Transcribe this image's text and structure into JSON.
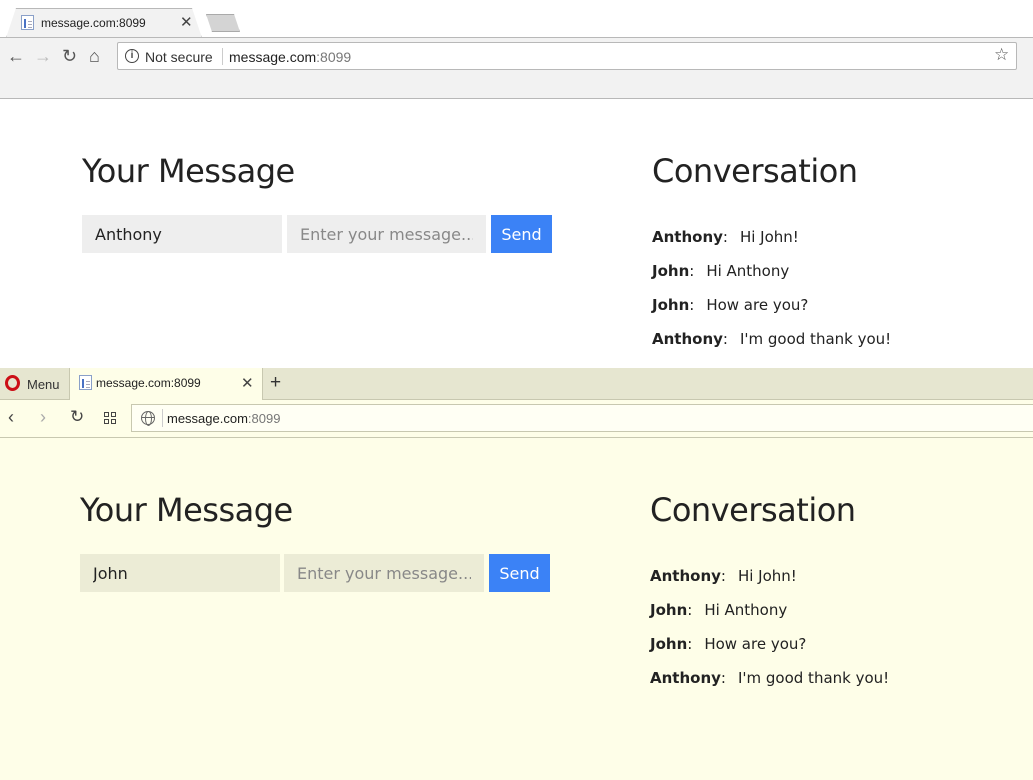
{
  "chrome": {
    "tab_title": "message.com:8099",
    "security_label": "Not secure",
    "url_host": "message.com",
    "url_port": ":8099"
  },
  "opera": {
    "menu_label": "Menu",
    "tab_title": "message.com:8099",
    "url_host": "message.com",
    "url_port": ":8099"
  },
  "app_chrome": {
    "title_left": "Your Message",
    "title_right": "Conversation",
    "name_value": "Anthony",
    "message_placeholder": "Enter your message...",
    "send_label": "Send",
    "messages": [
      {
        "sender": "Anthony",
        "text": "Hi John!"
      },
      {
        "sender": "John",
        "text": "Hi Anthony"
      },
      {
        "sender": "John",
        "text": "How are you?"
      },
      {
        "sender": "Anthony",
        "text": "I'm good thank you!"
      }
    ]
  },
  "app_opera": {
    "title_left": "Your Message",
    "title_right": "Conversation",
    "name_value": "John",
    "message_placeholder": "Enter your message...",
    "send_label": "Send",
    "messages": [
      {
        "sender": "Anthony",
        "text": "Hi John!"
      },
      {
        "sender": "John",
        "text": "Hi Anthony"
      },
      {
        "sender": "John",
        "text": "How are you?"
      },
      {
        "sender": "Anthony",
        "text": "I'm good thank you!"
      }
    ]
  },
  "colors": {
    "send_button": "#3b82f6",
    "chrome_input_bg": "#eeeeee",
    "opera_input_bg": "#ececd6",
    "opera_page_bg": "#fefee8"
  }
}
